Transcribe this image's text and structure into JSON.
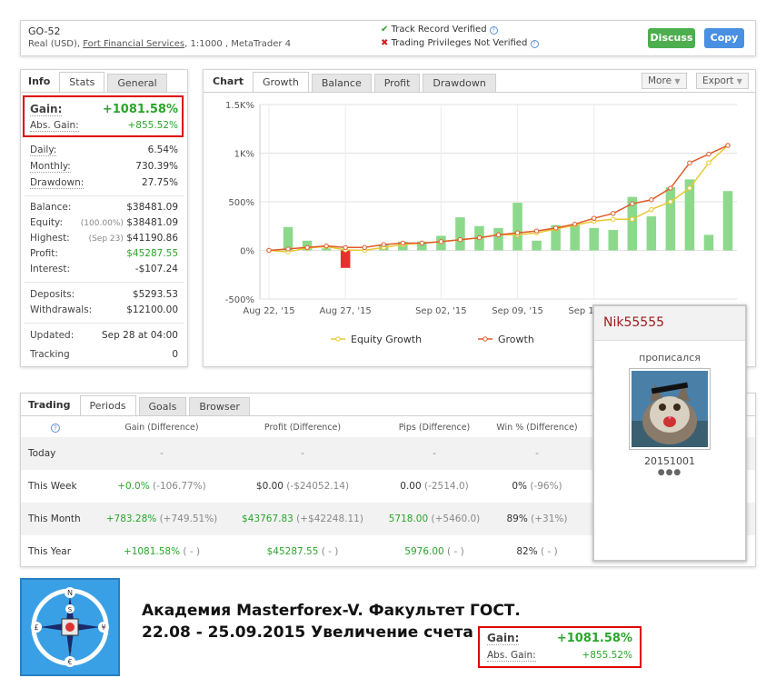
{
  "header": {
    "account_name": "GO-52",
    "account_type": "Real (USD), ",
    "broker_link": "Fort Financial Services",
    "account_details": ", 1:1000 , MetaTrader 4",
    "track_record": "Track Record Verified",
    "trading_privileges": "Trading Privileges Not Verified",
    "discuss_label": "Discuss",
    "copy_label": "Copy",
    "colors": {
      "discuss": "#4cae4c",
      "copy": "#4a90e2"
    }
  },
  "info": {
    "tabs": {
      "title": "Info",
      "stats": "Stats",
      "general": "General"
    },
    "gain_label": "Gain:",
    "gain_value": "+1081.58%",
    "abs_gain_label": "Abs. Gain:",
    "abs_gain_value": "+855.52%",
    "daily_label": "Daily:",
    "daily_value": "6.54%",
    "monthly_label": "Monthly:",
    "monthly_value": "730.39%",
    "drawdown_label": "Drawdown:",
    "drawdown_value": "27.75%",
    "balance_label": "Balance:",
    "balance_value": "$38481.09",
    "equity_label": "Equity:",
    "equity_pct": "(100.00%)",
    "equity_value": "$38481.09",
    "highest_label": "Highest:",
    "highest_date": "(Sep 23)",
    "highest_value": "$41190.86",
    "profit_label": "Profit:",
    "profit_value": "$45287.55",
    "interest_label": "Interest:",
    "interest_value": "-$107.24",
    "deposits_label": "Deposits:",
    "deposits_value": "$5293.53",
    "withdrawals_label": "Withdrawals:",
    "withdrawals_value": "$12100.00",
    "updated_label": "Updated:",
    "updated_value": "Sep 28 at 04:00",
    "tracking_label": "Tracking",
    "tracking_value": "0"
  },
  "chart_panel": {
    "title": "Chart",
    "tabs": [
      "Growth",
      "Balance",
      "Profit",
      "Drawdown"
    ],
    "more_label": "More",
    "export_label": "Export"
  },
  "chart_data": {
    "type": "bar",
    "ylim": [
      -500,
      1500
    ],
    "yticks": [
      "1.5K%",
      "1K%",
      "500%",
      "0%",
      "-500%"
    ],
    "ytick_values": [
      1500,
      1000,
      500,
      0,
      -500
    ],
    "xticks": [
      "Aug 22, '15",
      "Aug 27, '15",
      "Sep 02, '15",
      "Sep 09, '15",
      "Sep 15, '15"
    ],
    "xtick_index": [
      0,
      4,
      9,
      13,
      17
    ],
    "bars": [
      0,
      240,
      100,
      20,
      -180,
      0,
      60,
      90,
      90,
      150,
      340,
      250,
      230,
      490,
      100,
      260,
      270,
      230,
      210,
      550,
      350,
      650,
      730,
      160,
      610
    ],
    "series": [
      {
        "name": "Equity Growth",
        "values": [
          0,
          -15,
          25,
          40,
          5,
          0,
          30,
          60,
          75,
          90,
          110,
          130,
          160,
          160,
          180,
          220,
          260,
          300,
          320,
          320,
          420,
          500,
          640,
          900,
          1080
        ]
      },
      {
        "name": "Growth",
        "values": [
          0,
          15,
          30,
          45,
          30,
          30,
          60,
          75,
          75,
          90,
          110,
          130,
          160,
          180,
          200,
          230,
          270,
          330,
          380,
          480,
          520,
          640,
          900,
          990,
          1080
        ]
      }
    ],
    "colors": {
      "bar_pos": "#8cd98c",
      "bar_neg": "#e53030",
      "equity": "#e8c830",
      "growth": "#e05a2a"
    }
  },
  "trading": {
    "tabs": {
      "title": "Trading",
      "periods": "Periods",
      "goals": "Goals",
      "browser": "Browser"
    },
    "help_icon": "question-icon",
    "headers": [
      "Gain (Difference)",
      "Profit (Difference)",
      "Pips (Difference)",
      "Win % (Difference)"
    ],
    "rows": [
      {
        "label": "Today",
        "gain": "-",
        "gain_diff": "",
        "profit": "-",
        "profit_diff": "",
        "pips": "-",
        "pips_diff": "",
        "win": "-",
        "win_diff": ""
      },
      {
        "label": "This Week",
        "gain": "+0.0%",
        "gain_diff": " (-106.77%)",
        "profit": "$0.00",
        "profit_diff": " (-$24052.14)",
        "pips": "0.00",
        "pips_diff": " (-2514.0)",
        "win": "0%",
        "win_diff": " (-96%)"
      },
      {
        "label": "This Month",
        "gain": "+783.28%",
        "gain_diff": " (+749.51%)",
        "profit": "$43767.83",
        "profit_diff": " (+$42248.11)",
        "pips": "5718.00",
        "pips_diff": " (+5460.0)",
        "win": "89%",
        "win_diff": " (+31%)"
      },
      {
        "label": "This Year",
        "gain": "+1081.58%",
        "gain_diff": " ( - )",
        "profit": "$45287.55",
        "profit_diff": " ( - )",
        "pips": "5976.00",
        "pips_diff": " ( - )",
        "win": "82%",
        "win_diff": " ( - )"
      }
    ]
  },
  "popup": {
    "username": "Nik55555",
    "status": "прописался",
    "date": "20151001",
    "dots": "●●●"
  },
  "footer": {
    "line1": "Академия Masterforex-V.  Факультет ГОСТ.",
    "line2": "22.08 - 25.09.2015  Увеличение счета",
    "gain_label": "Gain:",
    "gain_value": "+1081.58%",
    "abs_gain_label": "Abs. Gain:",
    "abs_gain_value": "+855.52%",
    "logo_symbols": {
      "n": "N",
      "s": "S",
      "pound": "£",
      "yen": "¥",
      "dollar": "$",
      "euro": "€"
    }
  }
}
